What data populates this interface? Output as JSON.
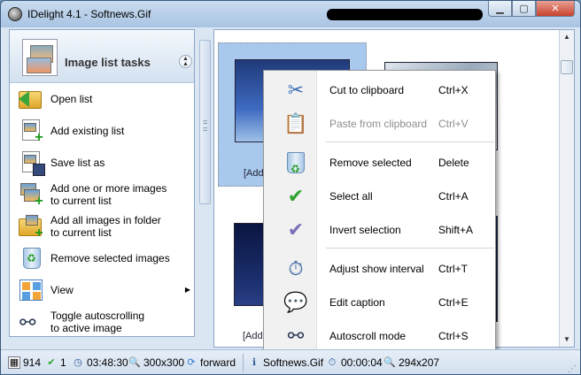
{
  "window": {
    "title": "IDelight 4.1 - Softnews.Gif",
    "buttons": {
      "minimize": "▁",
      "maximize": "▢",
      "close": "✕"
    }
  },
  "taskpane": {
    "title": "Image list tasks",
    "collapse_glyph": "▲\n▲",
    "items": [
      {
        "label_lines": [
          "Open list"
        ],
        "icon": "open-list-icon"
      },
      {
        "label_lines": [
          "Add existing list"
        ],
        "icon": "add-list-icon"
      },
      {
        "label_lines": [
          "Save list as"
        ],
        "icon": "save-list-icon"
      },
      {
        "label_lines": [
          "Add one or more images",
          "to current list"
        ],
        "icon": "add-images-icon"
      },
      {
        "label_lines": [
          "Add all images in folder",
          "to current list"
        ],
        "icon": "add-folder-icon"
      },
      {
        "label_lines": [
          "Remove selected images"
        ],
        "icon": "recycle-bin-icon"
      },
      {
        "label_lines": [
          "View"
        ],
        "icon": "view-icon",
        "has_submenu": true
      },
      {
        "label_lines": [
          "Toggle autoscrolling",
          "to active image"
        ],
        "icon": "binoculars-icon"
      }
    ]
  },
  "thumbnails": [
    {
      "caption": "[Add",
      "selected": true
    },
    {
      "caption": "",
      "selected": false
    },
    {
      "caption": "[Add",
      "selected": false
    },
    {
      "caption": "",
      "selected": false
    }
  ],
  "context_menu": {
    "items": [
      {
        "label": "Cut to clipboard",
        "shortcut": "Ctrl+X",
        "icon": "scissors-icon",
        "enabled": true
      },
      {
        "label": "Paste from clipboard",
        "shortcut": "Ctrl+V",
        "icon": "clipboard-icon",
        "enabled": false
      },
      {
        "label": "Remove selected",
        "shortcut": "Delete",
        "icon": "recycle-bin-icon",
        "enabled": true
      },
      {
        "label": "Select all",
        "shortcut": "Ctrl+A",
        "icon": "green-check-icon",
        "enabled": true
      },
      {
        "label": "Invert selection",
        "shortcut": "Shift+A",
        "icon": "purple-check-icon",
        "enabled": true
      },
      {
        "label": "Adjust show interval",
        "shortcut": "Ctrl+T",
        "icon": "stopwatch-icon",
        "enabled": true
      },
      {
        "label": "Edit caption",
        "shortcut": "Ctrl+E",
        "icon": "speech-bubble-icon",
        "enabled": true
      },
      {
        "label": "Autoscroll mode",
        "shortcut": "Ctrl+S",
        "icon": "binoculars-icon",
        "enabled": true
      }
    ]
  },
  "statusbar": {
    "image_count": "914",
    "selected_count": "1",
    "total_duration": "03:48:30",
    "thumb_size": "300x300",
    "direction": "forward",
    "current_file": "Softnews.Gif",
    "interval": "00:00:04",
    "image_size": "294x207"
  },
  "colors": {
    "selection": "#a8c8ee",
    "accent": "#3a5a7e"
  }
}
